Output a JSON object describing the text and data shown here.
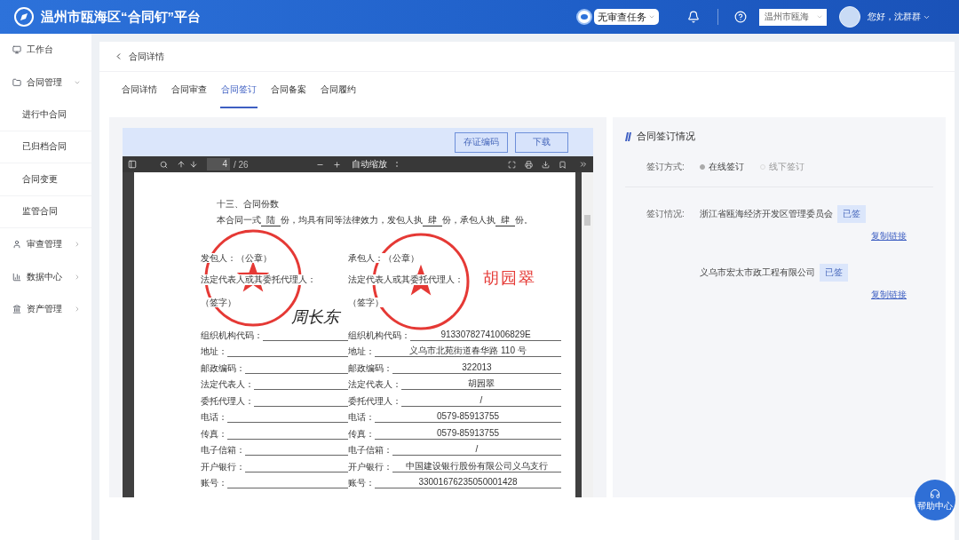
{
  "header": {
    "title": "温州市瓯海区“合同钉”平台",
    "task_pill": "无审查任务",
    "region_select": "温州市瓯海",
    "greeting": "您好，沈群群"
  },
  "sidebar": {
    "items": [
      {
        "label": "工作台"
      },
      {
        "label": "合同管理",
        "expanded": true,
        "children": [
          {
            "label": "进行中合同"
          },
          {
            "label": "已归档合同"
          },
          {
            "label": "合同变更"
          },
          {
            "label": "监管合同"
          }
        ]
      },
      {
        "label": "审查管理",
        "expanded": false
      },
      {
        "label": "数据中心",
        "expanded": false
      },
      {
        "label": "资产管理",
        "expanded": false
      }
    ]
  },
  "page_title": "合同详情",
  "tabs": [
    {
      "label": "合同详情",
      "selected": false
    },
    {
      "label": "合同审查",
      "selected": false
    },
    {
      "label": "合同签订",
      "selected": true
    },
    {
      "label": "合同备案",
      "selected": false
    },
    {
      "label": "合同履约",
      "selected": false
    }
  ],
  "document_panel": {
    "buttons": [
      "存证编码",
      "下载"
    ],
    "viewer": {
      "page": "4",
      "page_count": "/ 26",
      "zoom": "自动缩放"
    },
    "document": {
      "heading": "十三、合同份数",
      "paragraph": [
        {
          "kind": "text",
          "text": "本合同一式"
        },
        {
          "kind": "blank",
          "text": "陆"
        },
        {
          "kind": "text",
          "text": "份，均具有同等法律效力，发包人执"
        },
        {
          "kind": "blank",
          "text": "肆"
        },
        {
          "kind": "text",
          "text": "份，承包人执"
        },
        {
          "kind": "blank",
          "text": "肆"
        },
        {
          "kind": "text",
          "text": "份。"
        }
      ],
      "parties": [
        {
          "seal_label": "发包人：（公章）",
          "rep_label": "法定代表人或其委托代理人：",
          "sign_label": "（签字）",
          "signature": "周长东"
        },
        {
          "seal_label": "承包人：（公章）",
          "rep_label": "法定代表人或其委托代理人：",
          "sign_label": "（签字）",
          "signature": "胡园翠"
        }
      ],
      "fields": [
        {
          "left": "组织机构代码：",
          "right": "组织机构代码：",
          "value": "91330782741006829E"
        },
        {
          "left": "地址：",
          "right": "地址：",
          "value": "义乌市北苑街道春华路 110 号"
        },
        {
          "left": "邮政编码：",
          "right": "邮政编码：",
          "value": "322013"
        },
        {
          "left": "法定代表人：",
          "right": "法定代表人：",
          "value": "胡园翠"
        },
        {
          "left": "委托代理人：",
          "right": "委托代理人：",
          "value": "/"
        },
        {
          "left": "电话：",
          "right": "电话：",
          "value": "0579-85913755"
        },
        {
          "left": "传真：",
          "right": "传真：",
          "value": "0579-85913755"
        },
        {
          "left": "电子信箱：",
          "right": "电子信箱：",
          "value": "/"
        },
        {
          "left": "开户银行：",
          "right": "开户银行：",
          "value": "中国建设银行股份有限公司义乌支行"
        },
        {
          "left": "账号：",
          "right": "账号：",
          "value": "33001676235050001428"
        }
      ]
    }
  },
  "signing_panel": {
    "title": "合同签订情况",
    "method": {
      "label": "签订方式:",
      "options": [
        {
          "label": "在线签订",
          "selected": true,
          "disabled": false
        },
        {
          "label": "线下签订",
          "selected": false,
          "disabled": true
        }
      ]
    },
    "status": {
      "label": "签订情况:",
      "parties": [
        {
          "name": "浙江省瓯海经济开发区管理委员会",
          "tag": "已签",
          "link": "复制链接"
        },
        {
          "name": "义乌市宏太市政工程有限公司",
          "tag": "已签",
          "link": "复制链接"
        }
      ]
    }
  },
  "help_button": {
    "label": "帮助中心"
  }
}
